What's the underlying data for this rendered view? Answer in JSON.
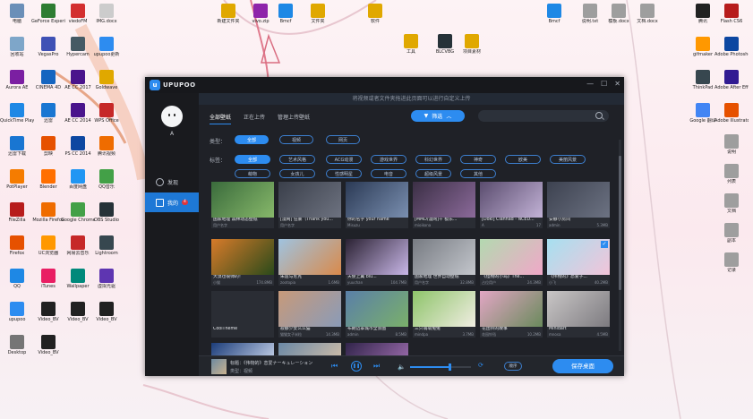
{
  "desktop": {
    "icons_left": [
      {
        "label": "电脑",
        "color": "#6b8fb8"
      },
      {
        "label": "GeForce Experience",
        "color": "#2e7d32"
      },
      {
        "label": "viedoFM",
        "color": "#d32f2f"
      },
      {
        "label": "IMG.docx",
        "color": "#cccccc"
      },
      {
        "label": "回收站",
        "color": "#7ea6c9"
      },
      {
        "label": "VegasPro",
        "color": "#3f51b5"
      },
      {
        "label": "Hypercam",
        "color": "#455a64"
      },
      {
        "label": "upupoo更新",
        "color": "#2d8cf0"
      },
      {
        "label": "Aurora AE",
        "color": "#7b1fa2"
      },
      {
        "label": "CINEMA 4D",
        "color": "#1565c0"
      },
      {
        "label": "AE CC 2017",
        "color": "#4a148c"
      },
      {
        "label": "Goldwave",
        "color": "#e0a800"
      },
      {
        "label": "QuickTime Player",
        "color": "#1e88e5"
      },
      {
        "label": "迅雷",
        "color": "#1976d2"
      },
      {
        "label": "AE CC 2014",
        "color": "#4a148c"
      },
      {
        "label": "WPS Office",
        "color": "#c62828"
      },
      {
        "label": "迅雷下载",
        "color": "#1976d2"
      },
      {
        "label": "剪映",
        "color": "#e65100"
      },
      {
        "label": "PS CC 2014",
        "color": "#0d47a1"
      },
      {
        "label": "腾讯视频",
        "color": "#ef6c00"
      },
      {
        "label": "PotPlayer",
        "color": "#f57c00"
      },
      {
        "label": "Blender",
        "color": "#ff6f00"
      },
      {
        "label": "百度网盘",
        "color": "#2196f3"
      },
      {
        "label": "QQ音乐",
        "color": "#43a047"
      },
      {
        "label": "FileZilla",
        "color": "#b71c1c"
      },
      {
        "label": "Mozilla Firefox",
        "color": "#ef6c00"
      },
      {
        "label": "Google Chrome",
        "color": "#43a047"
      },
      {
        "label": "OBS Studio",
        "color": "#263238"
      },
      {
        "label": "Firefox",
        "color": "#e65100"
      },
      {
        "label": "UC浏览器",
        "color": "#ff9800"
      },
      {
        "label": "网易云音乐",
        "color": "#c62828"
      },
      {
        "label": "Lightroom",
        "color": "#37474f"
      },
      {
        "label": "QQ",
        "color": "#1e88e5"
      },
      {
        "label": "iTunes",
        "color": "#e91e63"
      },
      {
        "label": "Wallpaper",
        "color": "#00897b"
      },
      {
        "label": "虚拟光驱",
        "color": "#5e35b1"
      },
      {
        "label": "upupoo",
        "color": "#2d8cf0"
      },
      {
        "label": "Video_BV",
        "color": "#212121"
      },
      {
        "label": "Video_BV",
        "color": "#212121"
      },
      {
        "label": "Video_BV",
        "color": "#212121"
      },
      {
        "label": "Desktop",
        "color": "#757575"
      },
      {
        "label": "Video_BV",
        "color": "#212121"
      }
    ],
    "icons_top": [
      {
        "label": "新建文件夹",
        "color": "#e0a800"
      },
      {
        "label": "vivo.zip",
        "color": "#8e24aa"
      },
      {
        "label": "Bmcf",
        "color": "#1e88e5"
      },
      {
        "label": "文件夹",
        "color": "#e0a800"
      },
      {
        "label": "软件",
        "color": "#e0a800"
      },
      {
        "label": "工具",
        "color": "#e0a800"
      },
      {
        "label": "BLCVBG",
        "color": "#263238"
      },
      {
        "label": "项目素材",
        "color": "#e0a800"
      },
      {
        "label": "Bmcf",
        "color": "#1e88e5"
      },
      {
        "label": "说明.txt",
        "color": "#9e9e9e"
      },
      {
        "label": "模板.docx",
        "color": "#9e9e9e"
      },
      {
        "label": "文档.docx",
        "color": "#9e9e9e"
      }
    ],
    "icons_right": [
      {
        "label": "腾讯",
        "color": "#212121"
      },
      {
        "label": "Flash CS6",
        "color": "#b71c1c"
      },
      {
        "label": "gifmaker",
        "color": "#ff9800"
      },
      {
        "label": "Adobe Photoshop",
        "color": "#0d47a1"
      },
      {
        "label": "ThinkPad",
        "color": "#37474f"
      },
      {
        "label": "Adobe After Effects",
        "color": "#311b92"
      },
      {
        "label": "Google 翻译",
        "color": "#4285f4"
      },
      {
        "label": "Adobe Illustrator",
        "color": "#e65100"
      },
      {
        "label": "说明",
        "color": "#9e9e9e"
      },
      {
        "label": "列表",
        "color": "#9e9e9e"
      },
      {
        "label": "文档",
        "color": "#9e9e9e"
      },
      {
        "label": "副本",
        "color": "#9e9e9e"
      },
      {
        "label": "记录",
        "color": "#9e9e9e"
      }
    ]
  },
  "app": {
    "logo_text": "UPUPOO",
    "notice": "将视频或者文件夹拖进此页面可以进行自定义上传",
    "window_controls": [
      "—",
      "☐",
      "✕"
    ],
    "user": {
      "name": "A"
    },
    "nav": [
      {
        "label": "发现",
        "icon": "compass-icon"
      },
      {
        "label": "我的",
        "icon": "monitor-icon",
        "badge": "4"
      }
    ],
    "tabs": [
      "全部壁纸",
      "正在上传",
      "管理上传壁纸"
    ],
    "filter_label": "筛选",
    "search_placeholder": "",
    "type_label": "类型：",
    "types": [
      "全部",
      "视频",
      "网页"
    ],
    "tag_label": "标签：",
    "tags_row1": [
      "全部",
      "艺术风格",
      "ACG动漫",
      "游戏世界",
      "科幻世界",
      "神奇",
      "欧美",
      "美丽风景"
    ],
    "tags_row2": [
      "萌物",
      "女孩儿",
      "性感明星",
      "电音",
      "超级风景",
      "其他"
    ],
    "cards": [
      {
        "caption": "国家地理 森林动态壁纸",
        "meta": "用户名字",
        "size": "",
        "colors": [
          "#3a6b3c",
          "#87b86a"
        ],
        "checked": false
      },
      {
        "caption": "[漫网] 狂暴（Thank you...",
        "meta": "用户名字",
        "size": "",
        "colors": [
          "#3a3f4a",
          "#6d7280"
        ],
        "checked": false
      },
      {
        "caption": "你的名字 your name",
        "meta": "Misuzu",
        "size": "",
        "colors": [
          "#2b3a55",
          "#7a8fb0"
        ],
        "checked": false
      },
      {
        "caption": "[MMD/漫网]干 极乐...",
        "meta": "mioikona",
        "size": "",
        "colors": [
          "#3b2f45",
          "#8b6a9a"
        ],
        "checked": false
      },
      {
        "caption": "[Doki] Clannad - NCED...",
        "meta": "A",
        "size": "17",
        "colors": [
          "#5a4c6e",
          "#c2b2d6"
        ],
        "checked": false
      },
      {
        "caption": "安静小房间",
        "meta": "admin",
        "size": "5.3MB",
        "colors": [
          "#3d4250",
          "#6c7282"
        ],
        "checked": false
      },
      {
        "caption": "大漠也很帅的！",
        "meta": "小猫",
        "size": "174.8MB",
        "colors": [
          "#d87b2a",
          "#2a4a1a"
        ],
        "checked": false
      },
      {
        "caption": "朱迪与尼克",
        "meta": "zootopia",
        "size": "1.6MB",
        "colors": [
          "#9fc3e0",
          "#d98a4b"
        ],
        "checked": false
      },
      {
        "caption": "天使上翼 blu...",
        "meta": "yuuchan",
        "size": "104.7MB",
        "colors": [
          "#2b2233",
          "#c9b7e8"
        ],
        "checked": false
      },
      {
        "caption": "国家地理 世界自动壁纸",
        "meta": "用户名字",
        "size": "32.8MB",
        "colors": [
          "#777b82",
          "#c3c6cc"
        ],
        "checked": false
      },
      {
        "caption": "《怪物的小岛》The...",
        "meta": "占位用户",
        "size": "24.3MB",
        "colors": [
          "#b3d9b0",
          "#f0a8c8"
        ],
        "checked": false
      },
      {
        "caption": "《伟物的》恐爱子...",
        "meta": "小飞",
        "size": "40.2MB",
        "colors": [
          "#a6e0f0",
          "#f2c4d9"
        ],
        "checked": true
      },
      {
        "caption": "CoolTheme",
        "meta": "",
        "size": "47.2MB",
        "colors": [
          "#2a2d34",
          "#2a2d34"
        ],
        "checked": false
      },
      {
        "caption": "寂静少女么么猫",
        "meta": "猫猫女子米粒",
        "size": "14.3MB",
        "colors": [
          "#c79a7a",
          "#8a9bb8"
        ],
        "checked": false
      },
      {
        "caption": "布朗迈泰城市全景图",
        "meta": "admin",
        "size": "8.5MB",
        "colors": [
          "#5a7fa8",
          "#7ab06a"
        ],
        "checked": false
      },
      {
        "caption": "三只萌萌兔兔",
        "meta": "mindpa",
        "size": "3.7MB",
        "colors": [
          "#8ec46a",
          "#f0ede2"
        ],
        "checked": false
      },
      {
        "caption": "花团铃的故事",
        "meta": "花园铃铛",
        "size": "10.2MB",
        "colors": [
          "#e2a6c4",
          "#6a8a5c"
        ],
        "checked": false
      },
      {
        "caption": "Minidart",
        "meta": "mnosa",
        "size": "4.5MB",
        "colors": [
          "#c9c6c6",
          "#7d7b80"
        ],
        "checked": false
      },
      {
        "caption": "",
        "meta": "",
        "size": "",
        "colors": [
          "#1c3d7a",
          "#e8f0ff"
        ],
        "checked": false
      },
      {
        "caption": "",
        "meta": "",
        "size": "",
        "colors": [
          "#6a88a6",
          "#e6c9a8"
        ],
        "checked": false
      },
      {
        "caption": "",
        "meta": "",
        "size": "",
        "colors": [
          "#31244a",
          "#b07ac0"
        ],
        "checked": false
      }
    ],
    "player": {
      "title": "标题：《伟物的》恋爱ナーキュレーション",
      "type": "类型：视频",
      "mode": "顺序"
    },
    "save_label": "保存桌面",
    "accent": "#2d8cf0"
  }
}
